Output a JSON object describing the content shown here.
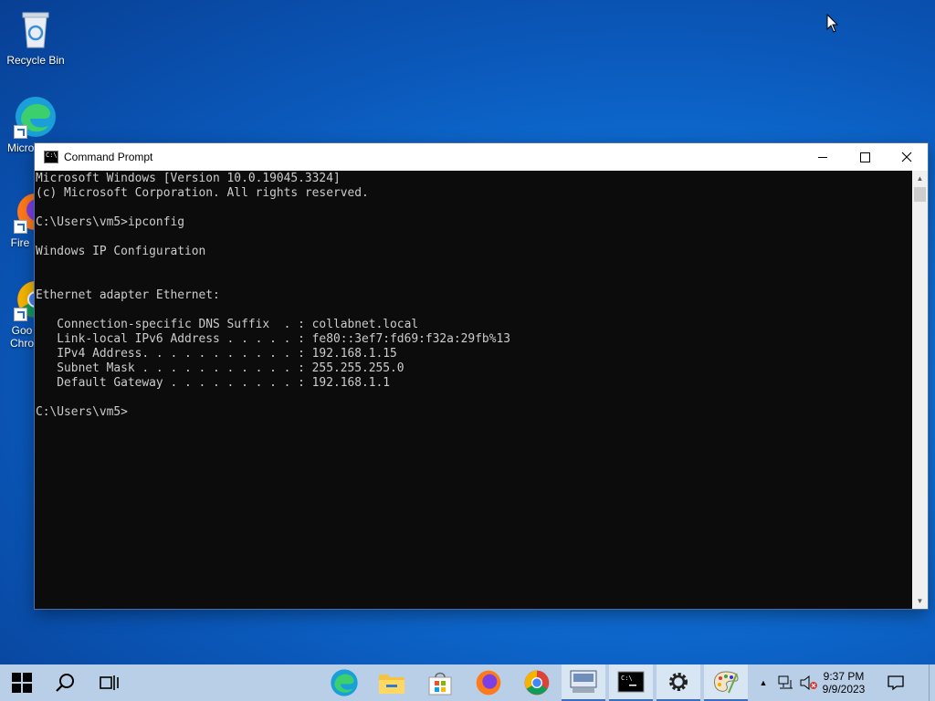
{
  "desktop": {
    "icons": [
      {
        "label": "Recycle Bin",
        "icon": "recycle-bin-icon"
      },
      {
        "label": "Micro Ed",
        "icon": "edge-icon"
      },
      {
        "label": "Fire",
        "icon": "firefox-icon"
      },
      {
        "label": "Goo Chro",
        "icon": "chrome-icon"
      }
    ]
  },
  "window": {
    "title": "Command Prompt",
    "icon": "cmd-icon",
    "console_text": "Microsoft Windows [Version 10.0.19045.3324]\n(c) Microsoft Corporation. All rights reserved.\n\nC:\\Users\\vm5>ipconfig\n\nWindows IP Configuration\n\n\nEthernet adapter Ethernet:\n\n   Connection-specific DNS Suffix  . : collabnet.local\n   Link-local IPv6 Address . . . . . : fe80::3ef7:fd69:f32a:29fb%13\n   IPv4 Address. . . . . . . . . . . : 192.168.1.15\n   Subnet Mask . . . . . . . . . . . : 255.255.255.0\n   Default Gateway . . . . . . . . . : 192.168.1.1\n\nC:\\Users\\vm5>"
  },
  "taskbar": {
    "pinned": [
      "start-icon",
      "search-icon",
      "task-view-icon",
      "edge-icon",
      "file-explorer-icon",
      "store-icon",
      "firefox-icon",
      "chrome-icon",
      "remote-desktop-icon",
      "cmd-icon",
      "settings-icon",
      "paint-icon"
    ],
    "clock_time": "9:37 PM",
    "clock_date": "9/9/2023"
  },
  "colors": {
    "console_bg": "#0c0c0c",
    "console_fg": "#cccccc",
    "taskbar": "#b9cfe8"
  }
}
